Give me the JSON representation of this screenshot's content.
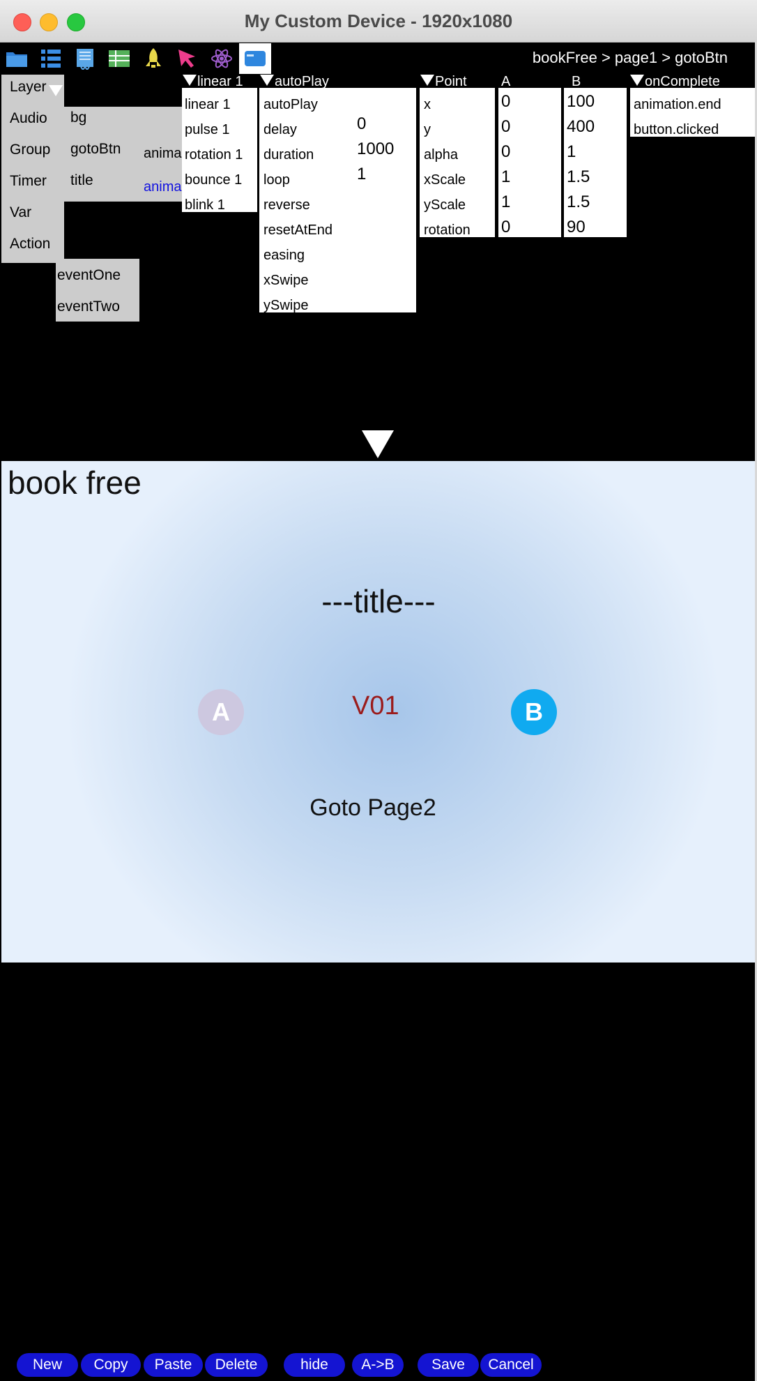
{
  "window": {
    "title": "My Custom Device - 1920x1080"
  },
  "toolbar": {
    "icons": [
      "folder-icon",
      "list-icon",
      "book-icon",
      "table-icon",
      "rocket-icon",
      "pointer-icon",
      "atom-icon",
      "screen-icon"
    ],
    "active_icon": "screen-icon"
  },
  "breadcrumb": "bookFree > page1 > gotoBtn",
  "menu": {
    "items": [
      "Layer",
      "Audio",
      "Group",
      "Timer",
      "Var",
      "Action"
    ],
    "layers": [
      "bg",
      "gotoBtn",
      "title"
    ],
    "anim_labels": [
      "anima",
      "anima"
    ],
    "events": [
      "eventOne",
      "eventTwo"
    ]
  },
  "animation": {
    "header": "linear 1",
    "items": [
      "linear 1",
      "pulse 1",
      "rotation 1",
      "bounce 1",
      "blink 1"
    ]
  },
  "props": {
    "header": "autoPlay",
    "keys": [
      "autoPlay",
      "delay",
      "duration",
      "loop",
      "reverse",
      "resetAtEnd",
      "easing",
      "xSwipe",
      "ySwipe"
    ],
    "values": {
      "delay": "0",
      "duration": "1000",
      "loop": "1"
    }
  },
  "point": {
    "header": "Point",
    "col_a": "A",
    "col_b": "B",
    "keys": [
      "x",
      "y",
      "alpha",
      "xScale",
      "yScale",
      "rotation"
    ],
    "a_values": [
      "0",
      "0",
      "0",
      "1",
      "1",
      "0"
    ],
    "b_values": [
      "100",
      "400",
      "1",
      "1.5",
      "1.5",
      "90"
    ]
  },
  "events_panel": {
    "header": "onComplete",
    "items": [
      "animation.end",
      "button.clicked"
    ]
  },
  "canvas": {
    "book_title": "book free",
    "title_text": "---title---",
    "btn_a": "A",
    "btn_b": "B",
    "version": "V01",
    "goto": "Goto Page2"
  },
  "buttons": [
    "New",
    "Copy",
    "Paste",
    "Delete",
    "hide",
    "A->B",
    "Save",
    "Cancel"
  ],
  "colors": {
    "button_bg": "#1414d2",
    "btn_b": "#10aaf0",
    "version_text": "#9b1c1c"
  }
}
